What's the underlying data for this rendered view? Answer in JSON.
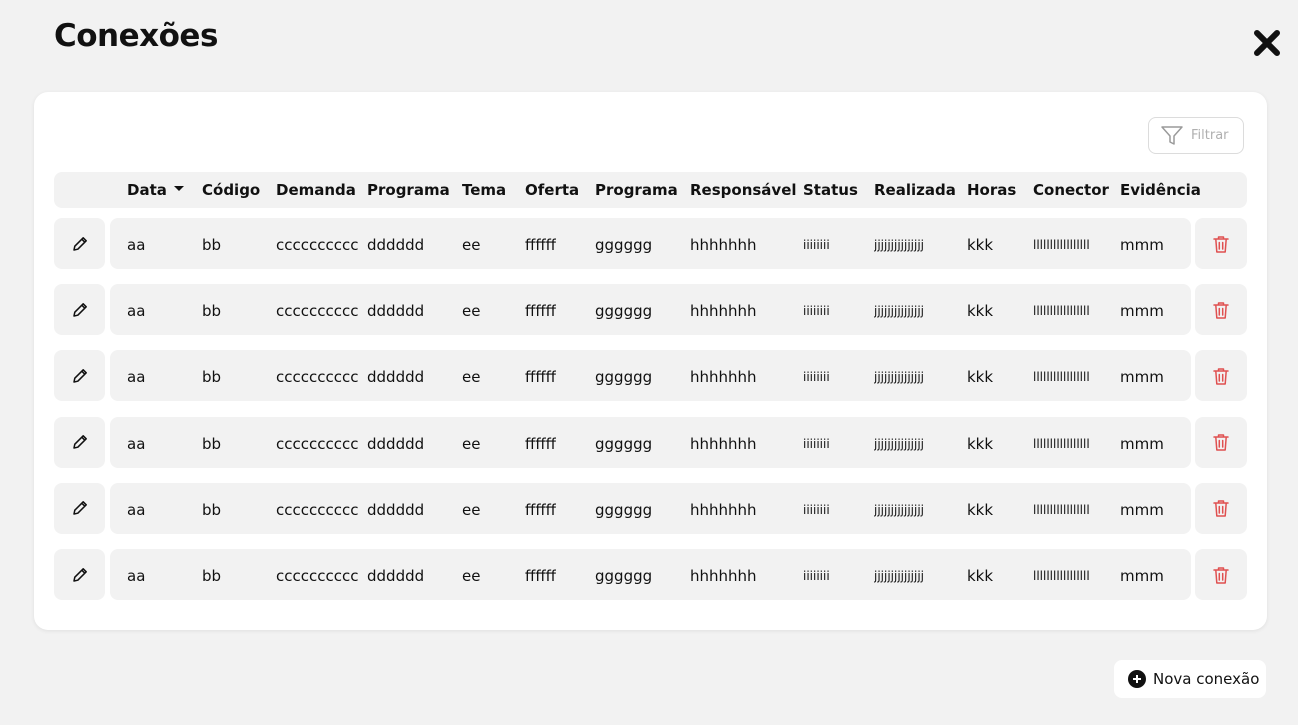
{
  "page": {
    "title": "Conexões"
  },
  "filter": {
    "label": "Filtrar"
  },
  "table": {
    "columns": [
      "Data",
      "Código",
      "Demanda",
      "Programa",
      "Tema",
      "Oferta",
      "Programa",
      "Responsável",
      "Status",
      "Realizada",
      "Horas",
      "Conector",
      "Evidência"
    ],
    "sorted_column": "Data",
    "rows": [
      [
        "aa",
        "bb",
        "cccccccccc",
        "dddddd",
        "ee",
        "ffffff",
        "gggggg",
        "hhhhhhh",
        "iiiiiiii",
        "jjjjjjjjjjjjjjj",
        "kkk",
        "lllllllllllllllll",
        "mmm"
      ],
      [
        "aa",
        "bb",
        "cccccccccc",
        "dddddd",
        "ee",
        "ffffff",
        "gggggg",
        "hhhhhhh",
        "iiiiiiii",
        "jjjjjjjjjjjjjjj",
        "kkk",
        "lllllllllllllllll",
        "mmm"
      ],
      [
        "aa",
        "bb",
        "cccccccccc",
        "dddddd",
        "ee",
        "ffffff",
        "gggggg",
        "hhhhhhh",
        "iiiiiiii",
        "jjjjjjjjjjjjjjj",
        "kkk",
        "lllllllllllllllll",
        "mmm"
      ],
      [
        "aa",
        "bb",
        "cccccccccc",
        "dddddd",
        "ee",
        "ffffff",
        "gggggg",
        "hhhhhhh",
        "iiiiiiii",
        "jjjjjjjjjjjjjjj",
        "kkk",
        "lllllllllllllllll",
        "mmm"
      ],
      [
        "aa",
        "bb",
        "cccccccccc",
        "dddddd",
        "ee",
        "ffffff",
        "gggggg",
        "hhhhhhh",
        "iiiiiiii",
        "jjjjjjjjjjjjjjj",
        "kkk",
        "lllllllllllllllll",
        "mmm"
      ],
      [
        "aa",
        "bb",
        "cccccccccc",
        "dddddd",
        "ee",
        "ffffff",
        "gggggg",
        "hhhhhhh",
        "iiiiiiii",
        "jjjjjjjjjjjjjjj",
        "kkk",
        "lllllllllllllllll",
        "mmm"
      ]
    ]
  },
  "actions": {
    "new_label": "Nova conexão"
  },
  "icons": {
    "close": "close-icon",
    "filter": "filter-icon",
    "edit": "pencil-icon",
    "delete": "trash-icon",
    "add": "plus-circle-icon",
    "sort": "caret-down-icon"
  },
  "colors": {
    "background": "#f2f2f2",
    "card": "#ffffff",
    "delete": "#e05050",
    "text": "#111111",
    "muted": "#b0b0b0"
  }
}
